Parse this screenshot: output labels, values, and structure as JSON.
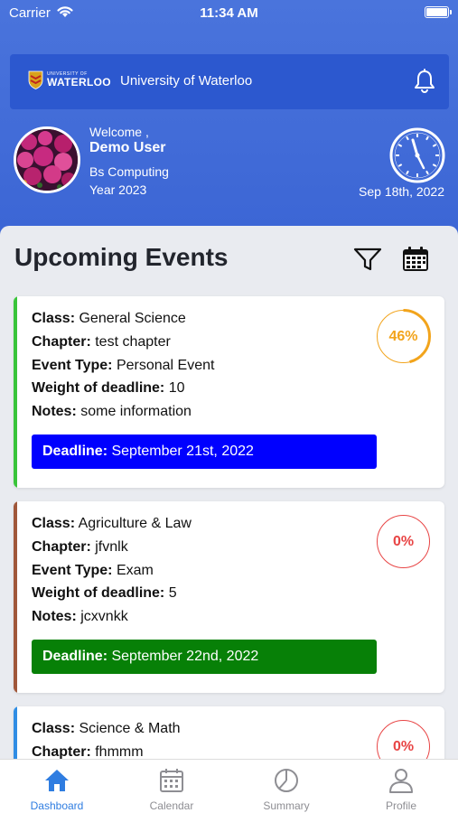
{
  "status_bar": {
    "carrier": "Carrier",
    "time": "11:34 AM"
  },
  "app_bar": {
    "logo_small": "UNIVERSITY OF",
    "logo_big": "WATERLOO",
    "title": "University of Waterloo"
  },
  "profile": {
    "welcome": "Welcome ,",
    "name": "Demo User",
    "program": "Bs Computing",
    "year": "Year 2023",
    "date": "Sep 18th, 2022"
  },
  "section_title": "Upcoming Events",
  "field_labels": {
    "class": "Class:",
    "chapter": "Chapter:",
    "event_type": "Event Type:",
    "weight": "Weight of deadline:",
    "notes": "Notes:",
    "deadline": "Deadline:"
  },
  "events": [
    {
      "class": "General Science",
      "chapter": "test chapter",
      "event_type": "Personal Event",
      "weight": "10",
      "notes": "some information",
      "deadline": "September 21st, 2022",
      "progress_label": "46%",
      "progress": 0.46,
      "stripe_color": "#39c43a",
      "deadline_color": "#0000ff",
      "progress_color": "#f2a41c"
    },
    {
      "class": "Agriculture & Law",
      "chapter": "jfvnlk",
      "event_type": "Exam",
      "weight": "5",
      "notes": "jcxvnkk",
      "deadline": "September 22nd, 2022",
      "progress_label": "0%",
      "progress": 0,
      "stripe_color": "#a0573a",
      "deadline_color": "#078007",
      "progress_color": "#e84545"
    },
    {
      "class": "Science & Math",
      "chapter": "fhmmm",
      "progress_label": "0%",
      "progress": 0,
      "stripe_color": "#2f8de4",
      "progress_color": "#e84545"
    }
  ],
  "tabs": [
    {
      "label": "Dashboard",
      "icon": "home-icon",
      "active": true
    },
    {
      "label": "Calendar",
      "icon": "calendar-icon",
      "active": false
    },
    {
      "label": "Summary",
      "icon": "pie-chart-icon",
      "active": false
    },
    {
      "label": "Profile",
      "icon": "person-icon",
      "active": false
    }
  ],
  "colors": {
    "accent": "#2f7de1",
    "header": "#3a64d4",
    "inactive_tab": "#8e8e93"
  }
}
